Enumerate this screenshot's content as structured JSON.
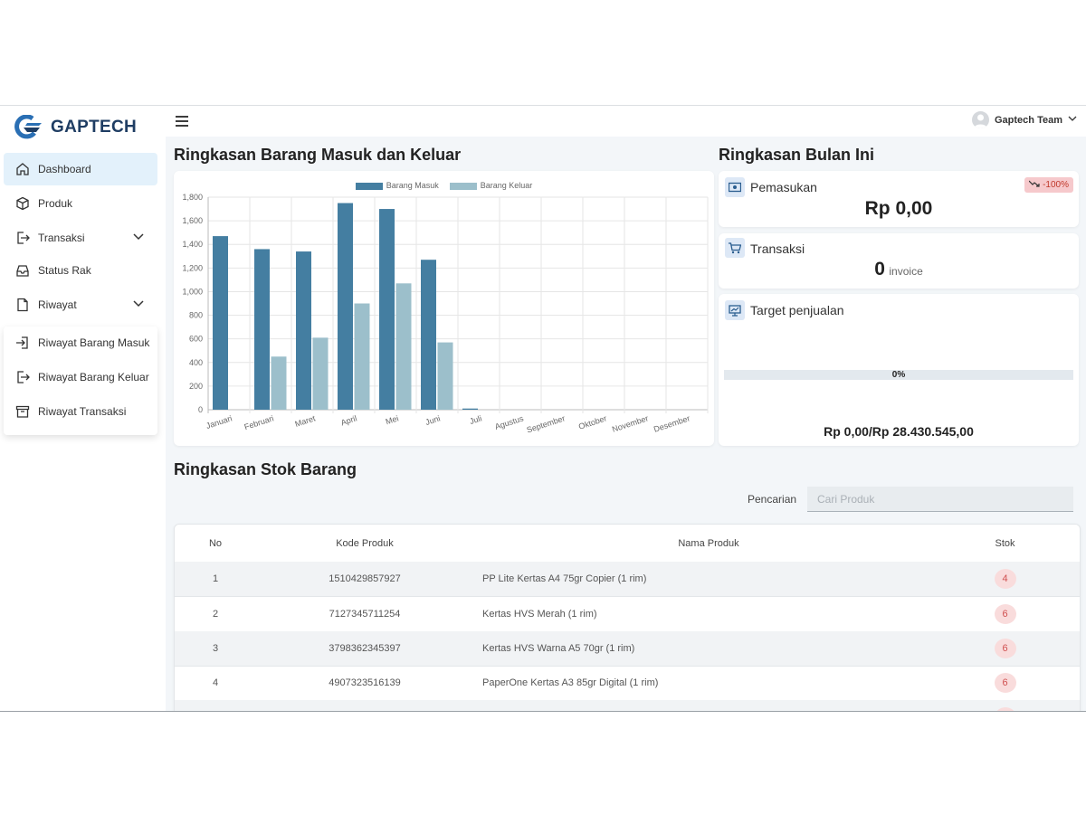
{
  "brand": {
    "name": "GAPTECH"
  },
  "sidebar": {
    "items": [
      {
        "label": "Dashboard",
        "icon": "home-icon",
        "active": true
      },
      {
        "label": "Produk",
        "icon": "box-icon"
      },
      {
        "label": "Transaksi",
        "icon": "sign-out-icon",
        "has_submenu": true
      },
      {
        "label": "Status Rak",
        "icon": "inbox-icon"
      },
      {
        "label": "Riwayat",
        "icon": "file-icon",
        "has_submenu": true
      }
    ],
    "submenu": [
      {
        "label": "Riwayat Barang Masuk",
        "icon": "sign-in-icon"
      },
      {
        "label": "Riwayat Barang Keluar",
        "icon": "sign-out-icon"
      },
      {
        "label": "Riwayat Transaksi",
        "icon": "archive-icon"
      }
    ]
  },
  "topbar": {
    "user_name": "Gaptech Team"
  },
  "chart_section": {
    "title": "Ringkasan Barang Masuk dan Keluar"
  },
  "chart_data": {
    "type": "bar",
    "categories": [
      "Januari",
      "Februari",
      "Maret",
      "April",
      "Mei",
      "Juni",
      "Juli",
      "Agustus",
      "September",
      "Oktober",
      "November",
      "Desember"
    ],
    "series": [
      {
        "name": "Barang Masuk",
        "color": "#447ea1",
        "values": [
          1470,
          1360,
          1340,
          1750,
          1700,
          1270,
          10,
          0,
          0,
          0,
          0,
          0
        ]
      },
      {
        "name": "Barang Keluar",
        "color": "#9cbfcb",
        "values": [
          0,
          450,
          610,
          900,
          1070,
          570,
          0,
          0,
          0,
          0,
          0,
          0
        ]
      }
    ],
    "ylim": [
      0,
      1800
    ],
    "yticks": [
      "0",
      "200",
      "400",
      "600",
      "800",
      "1,000",
      "1,200",
      "1,400",
      "1,600",
      "1,800"
    ],
    "grid": true,
    "legend": "top-center"
  },
  "summary": {
    "title": "Ringkasan Bulan Ini",
    "income": {
      "label": "Pemasukan",
      "value": "Rp 0,00",
      "badge": "-100%",
      "badge_icon": "trend-down-icon"
    },
    "transactions": {
      "label": "Transaksi",
      "value": "0",
      "unit": "invoice"
    },
    "target": {
      "label": "Target penjualan",
      "progress_text": "0%",
      "progress": 0,
      "text": "Rp 0,00/Rp 28.430.545,00"
    }
  },
  "stock": {
    "title": "Ringkasan Stok Barang",
    "search_label": "Pencarian",
    "search_placeholder": "Cari Produk",
    "columns": [
      "No",
      "Kode Produk",
      "Nama Produk",
      "Stok"
    ],
    "rows": [
      {
        "no": "1",
        "kode": "1510429857927",
        "nama": "PP Lite Kertas A4 75gr Copier (1 rim)",
        "stok": "4"
      },
      {
        "no": "2",
        "kode": "7127345711254",
        "nama": "Kertas HVS Merah (1 rim)",
        "stok": "6"
      },
      {
        "no": "3",
        "kode": "3798362345397",
        "nama": "Kertas HVS Warna A5 70gr (1 rim)",
        "stok": "6"
      },
      {
        "no": "4",
        "kode": "4907323516139",
        "nama": "PaperOne Kertas A3 85gr Digital (1 rim)",
        "stok": "6"
      }
    ]
  }
}
